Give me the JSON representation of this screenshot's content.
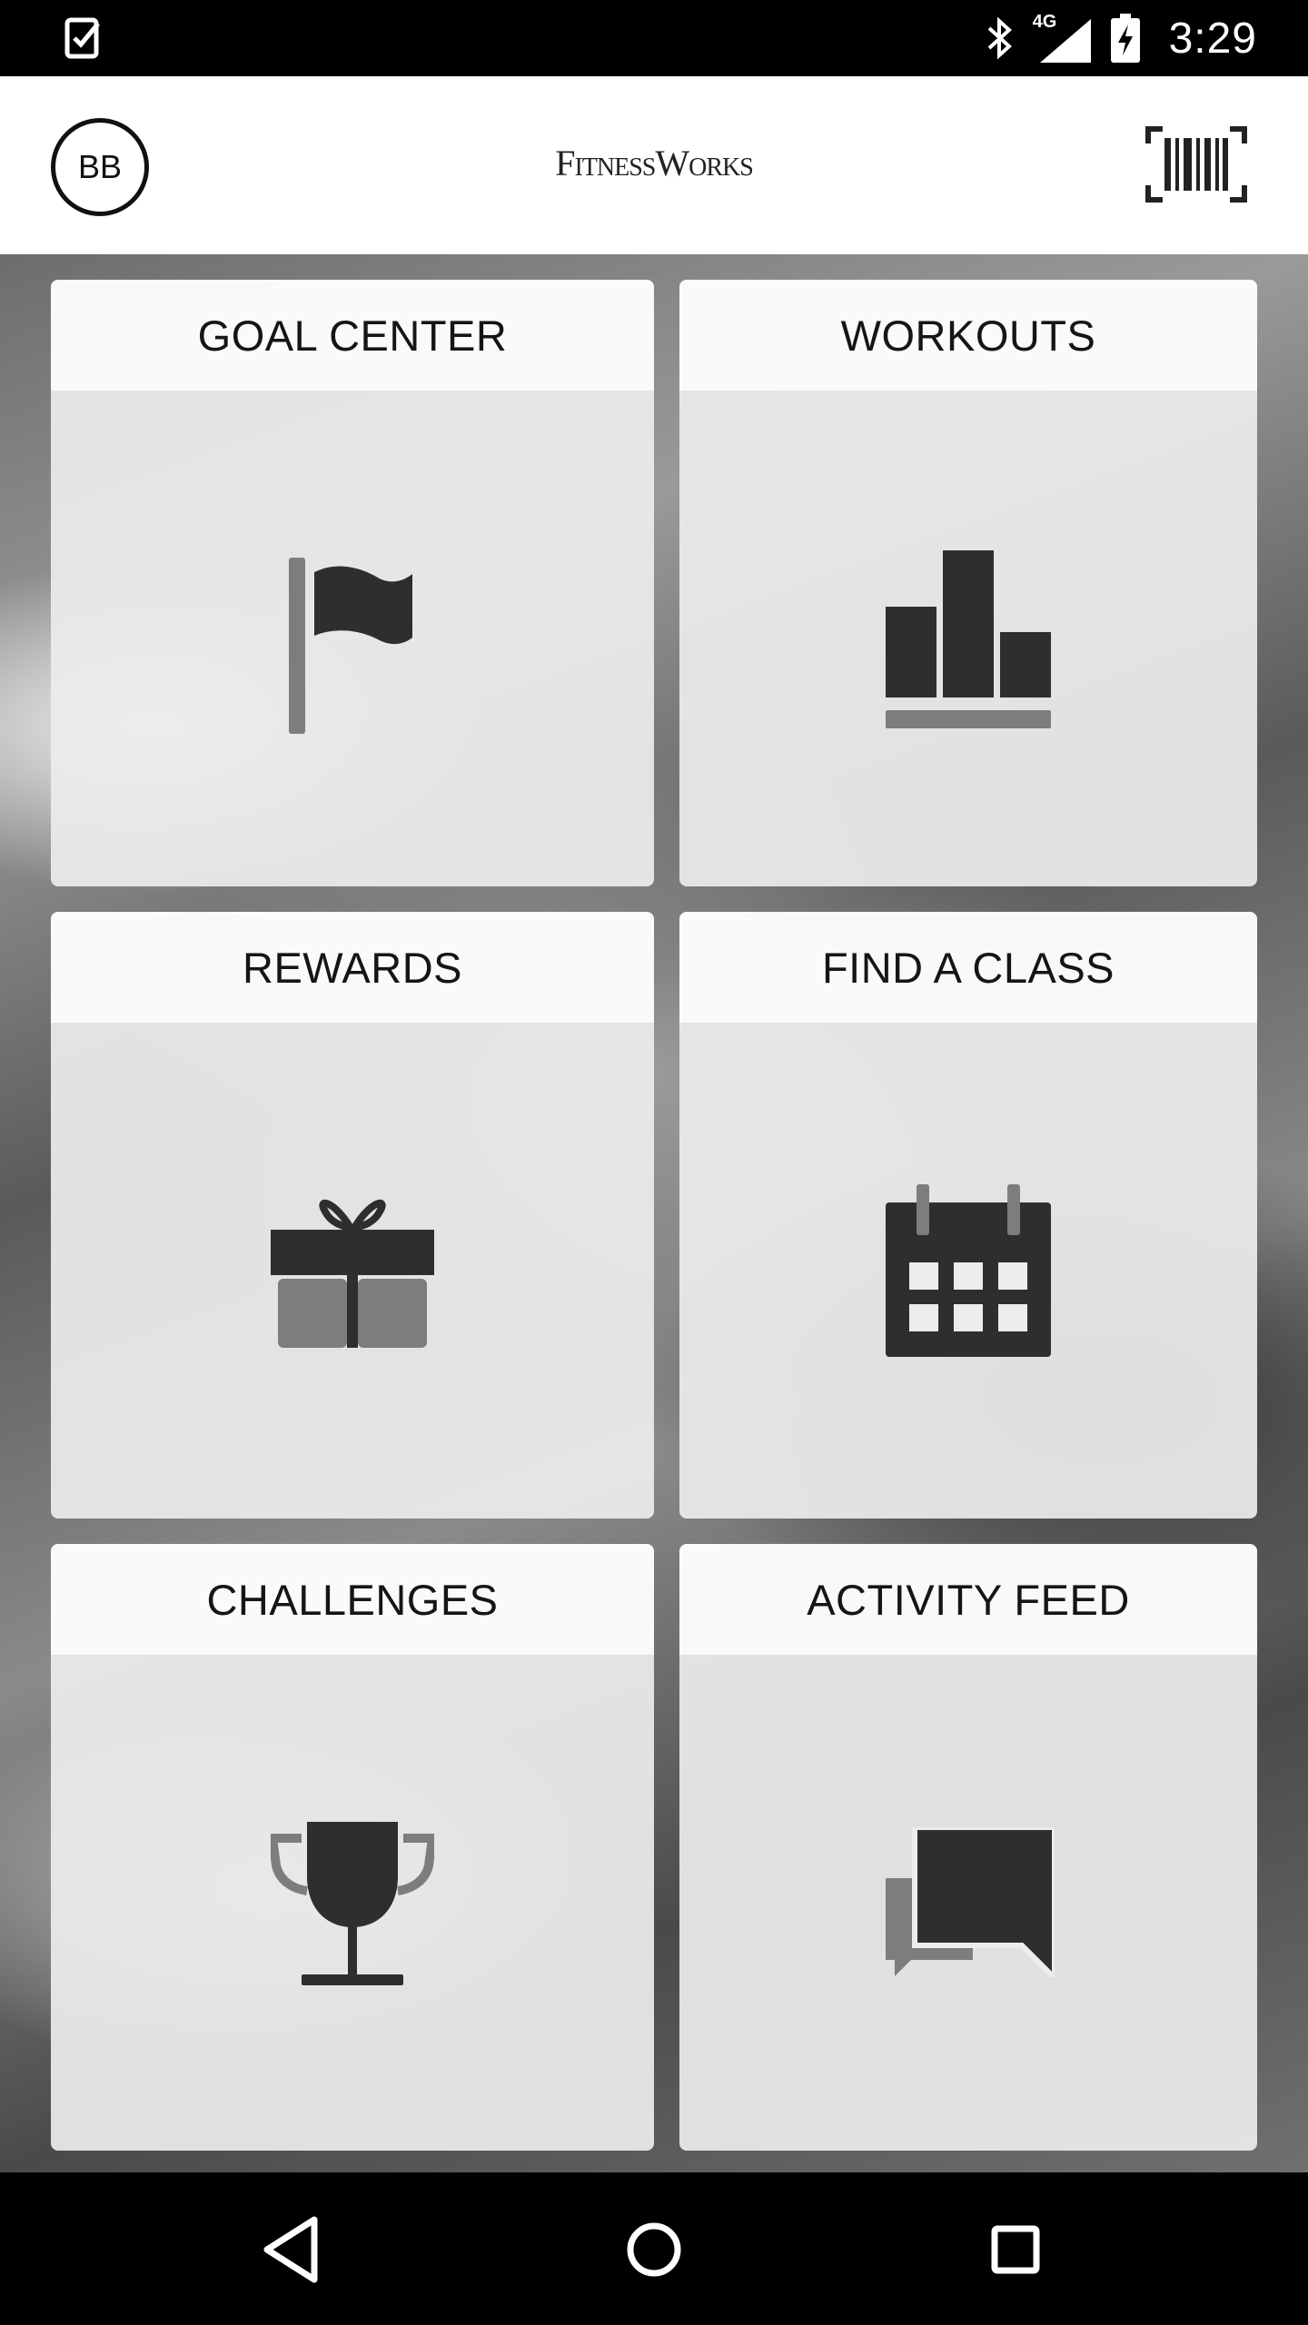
{
  "status_bar": {
    "time": "3:29",
    "network": "4G",
    "icons": [
      "task-check-icon",
      "bluetooth-icon",
      "signal-icon",
      "battery-charging-icon"
    ]
  },
  "header": {
    "avatar_initials": "BB",
    "brand": "FitnessWorks",
    "barcode_icon": "barcode-icon"
  },
  "tiles": [
    {
      "label": "GOAL CENTER",
      "icon": "flag-icon"
    },
    {
      "label": "WORKOUTS",
      "icon": "bar-chart-icon"
    },
    {
      "label": "REWARDS",
      "icon": "gift-icon"
    },
    {
      "label": "FIND A CLASS",
      "icon": "calendar-icon"
    },
    {
      "label": "CHALLENGES",
      "icon": "trophy-icon"
    },
    {
      "label": "ACTIVITY FEED",
      "icon": "chat-bubbles-icon"
    }
  ],
  "nav_bar": {
    "buttons": [
      "back-icon",
      "home-icon",
      "recents-icon"
    ]
  },
  "colors": {
    "icon_dark": "#2e2e2e",
    "icon_mid": "#7d7d7d",
    "tile_body": "#ececec",
    "tile_header": "#fafafa"
  }
}
